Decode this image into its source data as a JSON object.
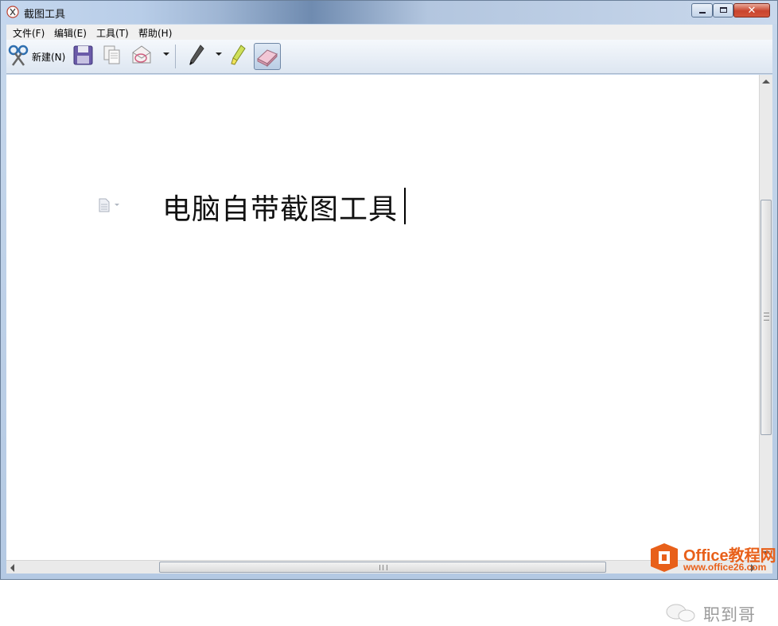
{
  "window": {
    "title": "截图工具",
    "close_symbol": "✕"
  },
  "menu": [
    {
      "label": "文件(F)"
    },
    {
      "label": "编辑(E)"
    },
    {
      "label": "工具(T)"
    },
    {
      "label": "帮助(H)"
    }
  ],
  "toolbar": {
    "new_label": "新建(N)",
    "icons": [
      "scissors-icon",
      "save-icon",
      "copy-icon",
      "send-email-icon",
      "dropdown-arrow-icon",
      "pen-icon",
      "highlighter-icon",
      "eraser-icon"
    ]
  },
  "canvas": {
    "heading": "电脑自带截图工具"
  },
  "watermark": {
    "name": "职到哥",
    "brand": "Office教程网",
    "url": "www.office26.com"
  },
  "colors": {
    "brand_orange": "#e8601a"
  }
}
